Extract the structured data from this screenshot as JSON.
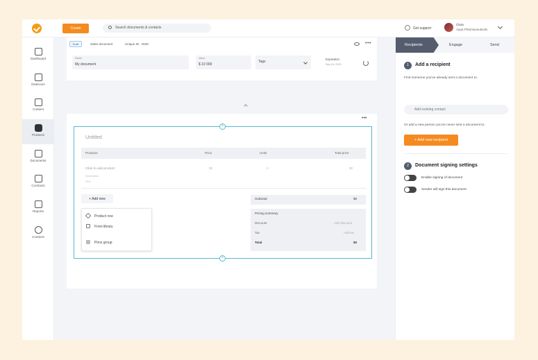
{
  "topbar": {
    "create_label": "Create",
    "search_placeholder": "Search documents & contacts",
    "support_label": "Get support",
    "user_name": "Clara",
    "user_company": "Aqua Pharmaceuticals"
  },
  "sidebar": {
    "items": [
      {
        "label": "Dashboard",
        "icon": "dashboard-icon"
      },
      {
        "label": "Dealroom",
        "icon": "dealroom-icon"
      },
      {
        "label": "Content",
        "icon": "folder-icon"
      },
      {
        "label": "Products",
        "icon": "cube-icon",
        "active": true
      },
      {
        "label": "Documents",
        "icon": "document-icon"
      },
      {
        "label": "Contracts",
        "icon": "pen-icon"
      },
      {
        "label": "Reports",
        "icon": "bar-chart-icon"
      },
      {
        "label": "Contacts",
        "icon": "contacts-icon"
      }
    ]
  },
  "doc": {
    "status": "Draft",
    "type": "Sales document",
    "unique_id": "Unique ID : 2629",
    "name_label": "Name",
    "name_value": "My document",
    "value_label": "Value",
    "value_value": "$  10 000",
    "tags_label": "Tags",
    "expiration_label": "Expiration",
    "expiration_date": "Sep 16, 2025"
  },
  "pricing_table": {
    "title": "Untitled",
    "columns": [
      "Products",
      "Price",
      "Units",
      "Total price"
    ],
    "row": {
      "product": "Click to add product",
      "description": "Description",
      "sku": "SKU",
      "price": "$0",
      "units": "0",
      "total": "$0"
    },
    "add_new_label": "Add new",
    "menu": [
      "Product row",
      "From library",
      "Price group"
    ],
    "subtotal_label": "Subtotal",
    "subtotal_value": "$0",
    "summary": {
      "title": "Pricing summary",
      "discount_label": "Discount",
      "discount_action": "Add discount",
      "tax_label": "Tax",
      "tax_action": "Add tax",
      "total_label": "Total",
      "total_value": "$0"
    }
  },
  "panel": {
    "tabs": [
      "Recipients",
      "Engage",
      "Send"
    ],
    "step1_num": "1",
    "step1_title": "Add a recipient",
    "step1_help": "Find someone you've already sent a document to.",
    "contact_placeholder": "Add existing contact",
    "new_person_help": "Or add a new person you've never sent a document to.",
    "add_recipient_label": "Add new recipient",
    "step2_num": "2",
    "step2_title": "Document signing settings",
    "toggle1_label": "Enable signing of document",
    "toggle2_label": "Sender will sign this document"
  },
  "colors": {
    "accent": "#f58a1f",
    "selection": "#56b8cd",
    "tab_active": "#545c6e"
  }
}
